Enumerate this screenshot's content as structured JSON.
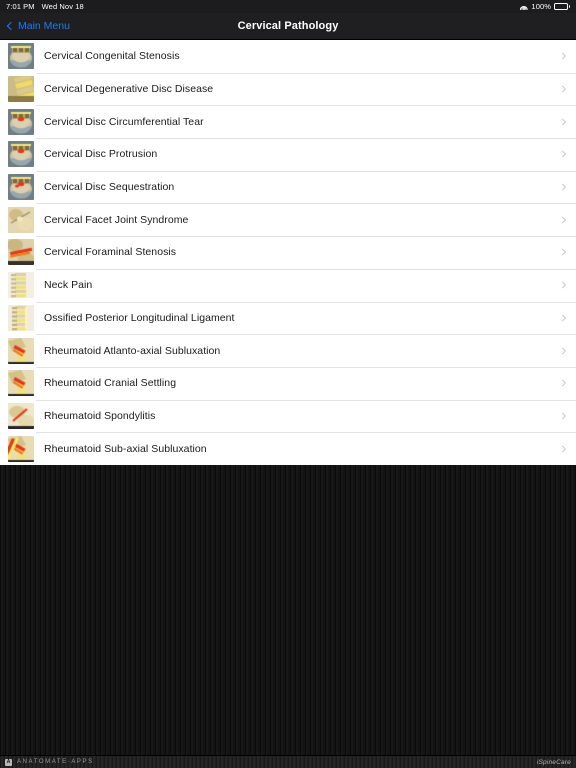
{
  "status_bar": {
    "time": "7:01 PM",
    "date": "Wed Nov 18",
    "wifi_icon": "wifi-icon",
    "battery_percent": "100%",
    "battery_icon": "battery-full-icon"
  },
  "nav_bar": {
    "back_icon": "chevron-left-icon",
    "back_label": "Main Menu",
    "title": "Cervical Pathology",
    "accent_color": "#1f7ce8",
    "background_color": "#1f1f21"
  },
  "list": {
    "disclosure_icon": "chevron-right-icon",
    "items": [
      {
        "label": "Cervical Congenital Stenosis",
        "thumb": "vertebra-axial-stenosis"
      },
      {
        "label": "Cervical Degenerative Disc Disease",
        "thumb": "spine-sagittal-degenerative"
      },
      {
        "label": "Cervical Disc Circumferential Tear",
        "thumb": "disc-axial-tear"
      },
      {
        "label": "Cervical Disc Protrusion",
        "thumb": "disc-axial-protrusion"
      },
      {
        "label": "Cervical Disc Sequestration",
        "thumb": "disc-axial-sequestration"
      },
      {
        "label": "Cervical Facet Joint Syndrome",
        "thumb": "facet-joint-lateral"
      },
      {
        "label": "Cervical Foraminal Stenosis",
        "thumb": "foramen-lateral-nerve"
      },
      {
        "label": "Neck Pain",
        "thumb": "cervical-spine-lateral"
      },
      {
        "label": "Ossified Posterior Longitudinal Ligament",
        "thumb": "opll-sagittal"
      },
      {
        "label": "Rheumatoid Atlanto-axial Subluxation",
        "thumb": "atlantoaxial-sagittal"
      },
      {
        "label": "Rheumatoid Cranial Settling",
        "thumb": "cranial-settling-sagittal"
      },
      {
        "label": "Rheumatoid Spondylitis",
        "thumb": "spondylitis-sagittal"
      },
      {
        "label": "Rheumatoid Sub-axial Subluxation",
        "thumb": "subaxial-sagittal"
      }
    ]
  },
  "bottom_bar": {
    "brand_mark_icon": "anatomate-logo-icon",
    "brand_mark_glyph": "A",
    "brand_text": "ANATOMATE·APPS",
    "app_name": "iSpineCare"
  }
}
